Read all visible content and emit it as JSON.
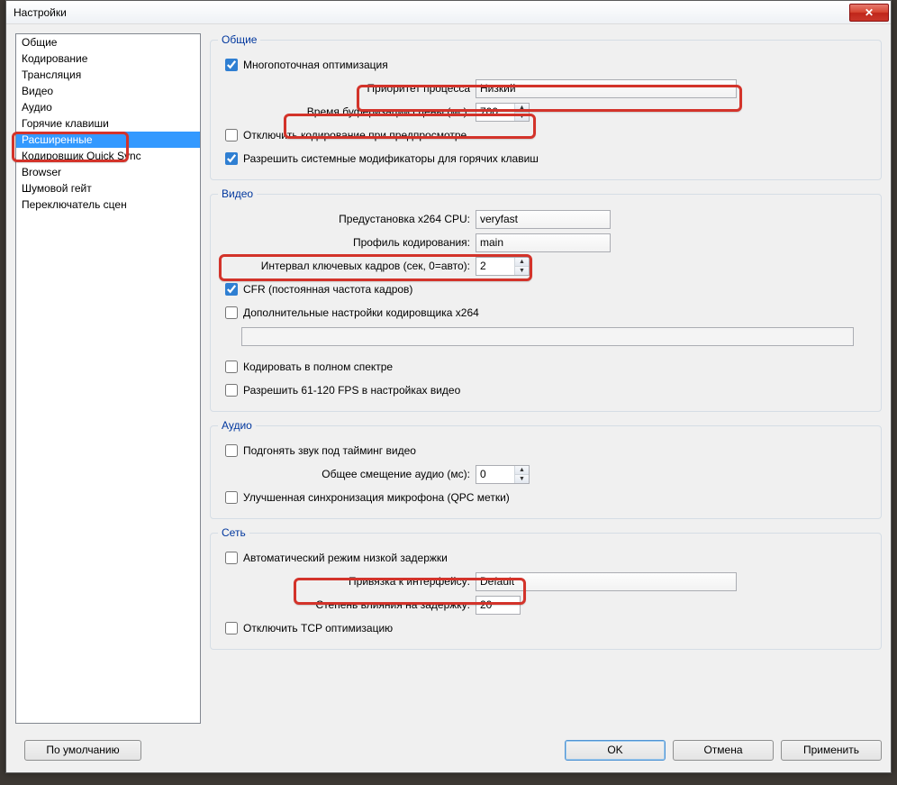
{
  "window_title": "Настройки",
  "sidebar": {
    "items": [
      {
        "label": "Общие"
      },
      {
        "label": "Кодирование"
      },
      {
        "label": "Трансляция"
      },
      {
        "label": "Видео"
      },
      {
        "label": "Аудио"
      },
      {
        "label": "Горячие клавиши"
      },
      {
        "label": "Расширенные",
        "selected": true
      },
      {
        "label": "Кодировщик Quick Sync"
      },
      {
        "label": "Browser"
      },
      {
        "label": "Шумовой гейт"
      },
      {
        "label": "Переключатель сцен"
      }
    ]
  },
  "groups": {
    "general": {
      "title": "Общие",
      "multicore": {
        "label": "Многопоточная оптимизация",
        "checked": true
      },
      "priority": {
        "label": "Приоритет процесса",
        "value": "Низкий"
      },
      "buffer": {
        "label": "Время буферизации сцены (мс):",
        "value": "700"
      },
      "disable_preview_encode": {
        "label": "Отключить кодирование при предпросмотре",
        "checked": false
      },
      "allow_hotkey_mods": {
        "label": "Разрешить системные модификаторы для горячих клавиш",
        "checked": true
      }
    },
    "video": {
      "title": "Видео",
      "preset": {
        "label": "Предустановка x264 CPU:",
        "value": "veryfast"
      },
      "profile": {
        "label": "Профиль кодирования:",
        "value": "main"
      },
      "keyint": {
        "label": "Интервал ключевых кадров (сек, 0=авто):",
        "value": "2"
      },
      "cfr": {
        "label": "CFR (постоянная частота кадров)",
        "checked": true
      },
      "extra_x264": {
        "label": "Дополнительные настройки кодировщика x264",
        "checked": false
      },
      "extra_x264_value": "",
      "full_range": {
        "label": "Кодировать в полном спектре",
        "checked": false
      },
      "allow_high_fps": {
        "label": "Разрешить 61-120 FPS в настройках видео",
        "checked": false
      }
    },
    "audio": {
      "title": "Аудио",
      "force_timing": {
        "label": "Подгонять звук под тайминг видео",
        "checked": false
      },
      "offset": {
        "label": "Общее смещение аудио (мс):",
        "value": "0"
      },
      "qpc": {
        "label": "Улучшенная синхронизация микрофона (QPC метки)",
        "checked": false
      }
    },
    "network": {
      "title": "Сеть",
      "auto_low_latency": {
        "label": "Автоматический режим низкой задержки",
        "checked": false
      },
      "bind": {
        "label": "Привязка к интерфейсу:",
        "value": "Default"
      },
      "latency_factor": {
        "label": "Степень влияния на задержку:",
        "value": "20"
      },
      "disable_tcp": {
        "label": "Отключить TCP оптимизацию",
        "checked": false
      }
    }
  },
  "buttons": {
    "defaults": "По умолчанию",
    "ok": "OK",
    "cancel": "Отмена",
    "apply": "Применить"
  }
}
